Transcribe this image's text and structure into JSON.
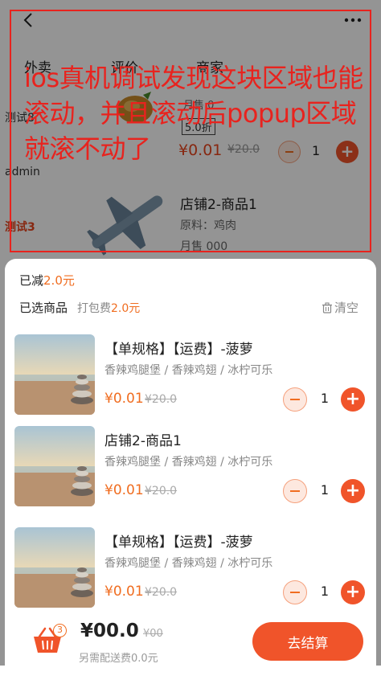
{
  "background": {
    "tabs": [
      "外卖",
      "评价",
      "商家"
    ],
    "side_items": [
      "测试8",
      "admin",
      "测试3"
    ],
    "active_side_item": "测试3",
    "product1": {
      "sold_label": "月售 0",
      "discount": "5.0折",
      "price": "¥0.01",
      "orig_price": "¥20.0",
      "qty": "1"
    },
    "product2": {
      "name": "店铺2-商品1",
      "material": "原料：鸡肉",
      "sold": "月售 000"
    }
  },
  "annotation": {
    "text": "ios真机调试发现这块区域也能滚动，并且滚动后popup区域就滚不动了"
  },
  "popup": {
    "reduced_prefix": "已减",
    "reduced_value": "2.0元",
    "selected_label": "已选商品",
    "pack_prefix": "打包费",
    "pack_value": "2.0元",
    "clear_label": "清空",
    "items": [
      {
        "name": "【单规格】【运费】-菠萝",
        "sides": "香辣鸡腿堡 / 香辣鸡翅 / 冰柠可乐",
        "price": "¥0.01",
        "orig_price": "¥20.0",
        "qty": "1"
      },
      {
        "name": "店铺2-商品1",
        "sides": "香辣鸡腿堡 / 香辣鸡翅 / 冰柠可乐",
        "price": "¥0.01",
        "orig_price": "¥20.0",
        "qty": "1"
      },
      {
        "name": "【单规格】【运费】-菠萝",
        "sides": "香辣鸡腿堡 / 香辣鸡翅 / 冰柠可乐",
        "price": "¥0.01",
        "orig_price": "¥20.0",
        "qty": "1"
      }
    ]
  },
  "bottom_bar": {
    "cart_count": "3",
    "total": "¥00.0",
    "total_orig": "¥00",
    "delivery": "另需配送费0.0元",
    "checkout_label": "去结算"
  },
  "colors": {
    "accent": "#f06d20",
    "button": "#f0542a",
    "annotation": "#e8231e"
  }
}
